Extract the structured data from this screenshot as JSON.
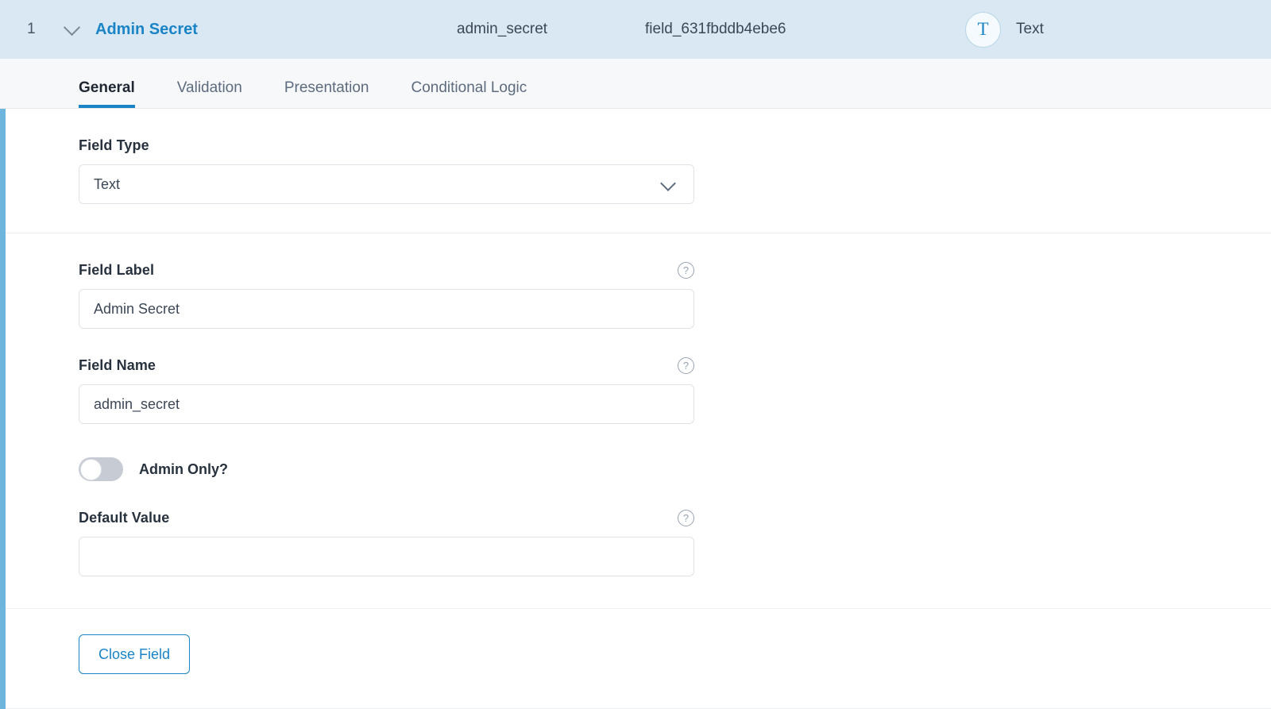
{
  "header": {
    "order_number": "1",
    "collapse_icon": "chevron-down-icon",
    "field_label": "Admin Secret",
    "field_name": "admin_secret",
    "field_key": "field_631fbddb4ebe6",
    "type_badge_glyph": "T",
    "type_name": "Text",
    "background_color": "#d9e8f2",
    "label_color": "#1a84c7"
  },
  "accent_color": "#6db5dc",
  "tabs": [
    {
      "label": "General",
      "active": true
    },
    {
      "label": "Validation",
      "active": false
    },
    {
      "label": "Presentation",
      "active": false
    },
    {
      "label": "Conditional Logic",
      "active": false
    }
  ],
  "general": {
    "field_type": {
      "label": "Field Type",
      "value": "Text",
      "chevron_icon": "chevron-down-icon"
    },
    "field_label": {
      "label": "Field Label",
      "value": "Admin Secret",
      "placeholder": "",
      "help_icon": "help-circle-icon"
    },
    "field_name": {
      "label": "Field Name",
      "value": "admin_secret",
      "placeholder": "",
      "help_icon": "help-circle-icon"
    },
    "admin_only": {
      "label": "Admin Only?",
      "enabled": false
    },
    "default_value": {
      "label": "Default Value",
      "value": "",
      "placeholder": "",
      "help_icon": "help-circle-icon"
    }
  },
  "footer": {
    "close_field_label": "Close Field",
    "accent_color": "#1a84c7"
  }
}
